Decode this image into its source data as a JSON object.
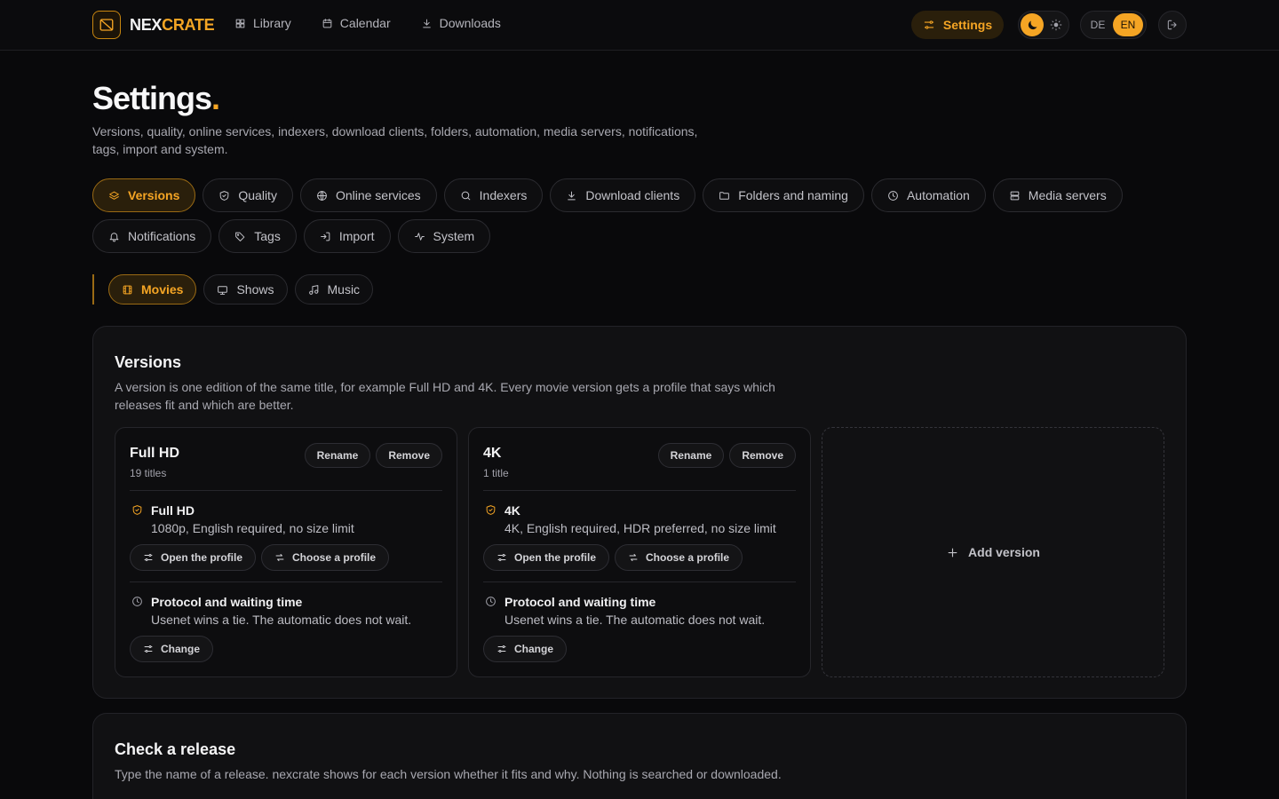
{
  "brand": {
    "name_part1": "NEX",
    "name_part2": "CRATE"
  },
  "nav": {
    "links": [
      {
        "label": "Library",
        "icon": "grid-icon"
      },
      {
        "label": "Calendar",
        "icon": "calendar-icon"
      },
      {
        "label": "Downloads",
        "icon": "download-icon"
      }
    ],
    "settings_label": "Settings",
    "languages": [
      "DE",
      "EN"
    ],
    "active_language": "EN",
    "theme": "dark"
  },
  "page": {
    "title": "Settings",
    "title_dot": ".",
    "description": "Versions, quality, online services, indexers, download clients, folders, automation, media servers, notifications, tags, import and system."
  },
  "tabs": [
    {
      "label": "Versions",
      "icon": "layers-icon",
      "active": true
    },
    {
      "label": "Quality",
      "icon": "shield-icon"
    },
    {
      "label": "Online services",
      "icon": "globe-icon"
    },
    {
      "label": "Indexers",
      "icon": "search-icon"
    },
    {
      "label": "Download clients",
      "icon": "download-icon"
    },
    {
      "label": "Folders and naming",
      "icon": "folder-icon"
    },
    {
      "label": "Automation",
      "icon": "clock-icon"
    },
    {
      "label": "Media servers",
      "icon": "server-icon"
    },
    {
      "label": "Notifications",
      "icon": "bell-icon"
    },
    {
      "label": "Tags",
      "icon": "tag-icon"
    },
    {
      "label": "Import",
      "icon": "import-icon"
    },
    {
      "label": "System",
      "icon": "activity-icon"
    }
  ],
  "media_tabs": [
    {
      "label": "Movies",
      "icon": "film-icon",
      "active": true
    },
    {
      "label": "Shows",
      "icon": "tv-icon"
    },
    {
      "label": "Music",
      "icon": "music-icon"
    }
  ],
  "versions": {
    "title": "Versions",
    "description": "A version is one edition of the same title, for example Full HD and 4K. Every movie version gets a profile that says which releases fit and which are better.",
    "items": [
      {
        "name": "Full HD",
        "count": "19 titles",
        "rename_label": "Rename",
        "remove_label": "Remove",
        "profile_title": "Full HD",
        "profile_desc": "1080p, English required, no size limit",
        "open_profile_label": "Open the profile",
        "choose_profile_label": "Choose a profile",
        "protocol_title": "Protocol and waiting time",
        "protocol_desc": "Usenet wins a tie. The automatic does not wait.",
        "change_label": "Change"
      },
      {
        "name": "4K",
        "count": "1 title",
        "rename_label": "Rename",
        "remove_label": "Remove",
        "profile_title": "4K",
        "profile_desc": "4K, English required, HDR preferred, no size limit",
        "open_profile_label": "Open the profile",
        "choose_profile_label": "Choose a profile",
        "protocol_title": "Protocol and waiting time",
        "protocol_desc": "Usenet wins a tie. The automatic does not wait.",
        "change_label": "Change"
      }
    ],
    "add_label": "Add version"
  },
  "check_release": {
    "title": "Check a release",
    "description": "Type the name of a release. nexcrate shows for each version whether it fits and why. Nothing is searched or downloaded."
  },
  "colors": {
    "accent": "#f5a524",
    "background": "#09090b",
    "card": "#111113"
  }
}
